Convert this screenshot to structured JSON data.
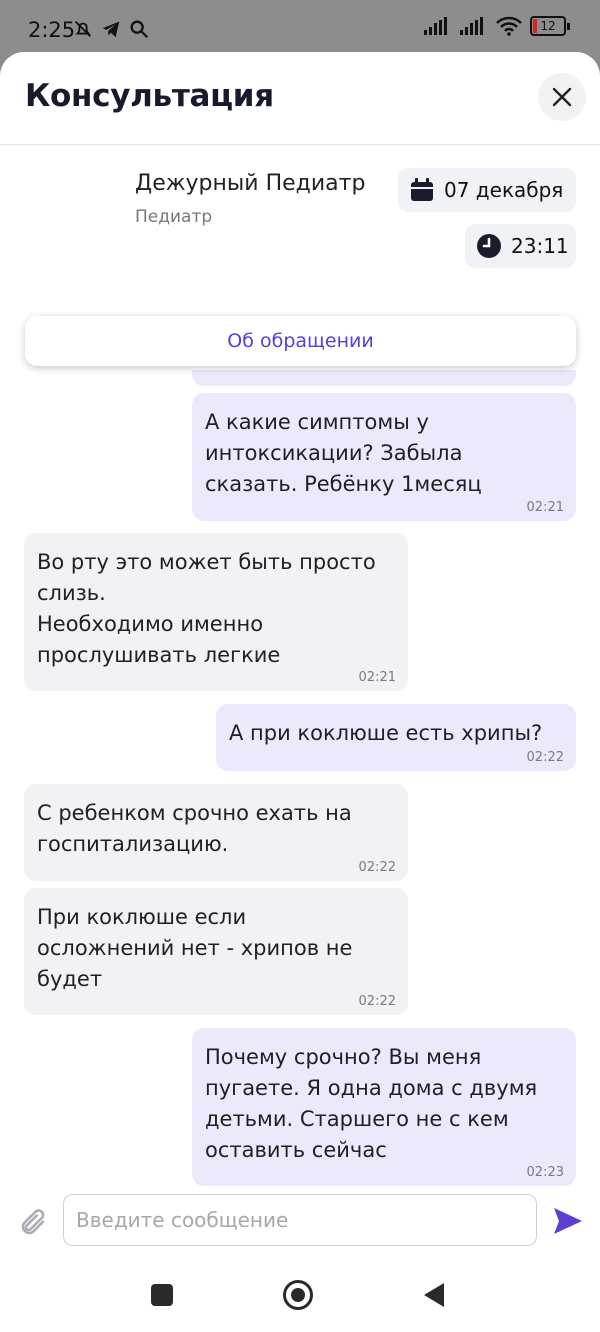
{
  "status_bar": {
    "time": "2:25",
    "battery": "12"
  },
  "header": {
    "title": "Консультация"
  },
  "doctor": {
    "name": "Дежурный Педиатр",
    "role": "Педиатр"
  },
  "appointment": {
    "date": "07 декабря",
    "time": "23:11"
  },
  "about_button": "Об обращении",
  "messages": [
    {
      "text": "А какие симптомы у\nинтоксикации? Забыла\nсказать. Ребёнку 1месяц",
      "time": "02:21",
      "direction": "out"
    },
    {
      "text": "Во рту это может быть просто\nслизь.\nНеобходимо именно\nпрослушивать легкие",
      "time": "02:21",
      "direction": "in"
    },
    {
      "text": "А при коклюше есть хрипы?",
      "time": "02:22",
      "direction": "out"
    },
    {
      "text": "С ребенком срочно ехать на\nгоспитализацию.",
      "time": "02:22",
      "direction": "in"
    },
    {
      "text": "При коклюше если\nосложнений нет - хрипов не\nбудет",
      "time": "02:22",
      "direction": "in"
    },
    {
      "text": "Почему срочно? Вы меня\nпугаете. Я одна дома с двумя\nдетьми. Старшего не с кем\nоставить сейчас",
      "time": "02:23",
      "direction": "out"
    }
  ],
  "composer": {
    "placeholder": "Введите сообщение"
  },
  "colors": {
    "accent": "#5b3ed4",
    "outgoing_bubble": "#ece9fc",
    "incoming_bubble": "#f2f2f4"
  }
}
